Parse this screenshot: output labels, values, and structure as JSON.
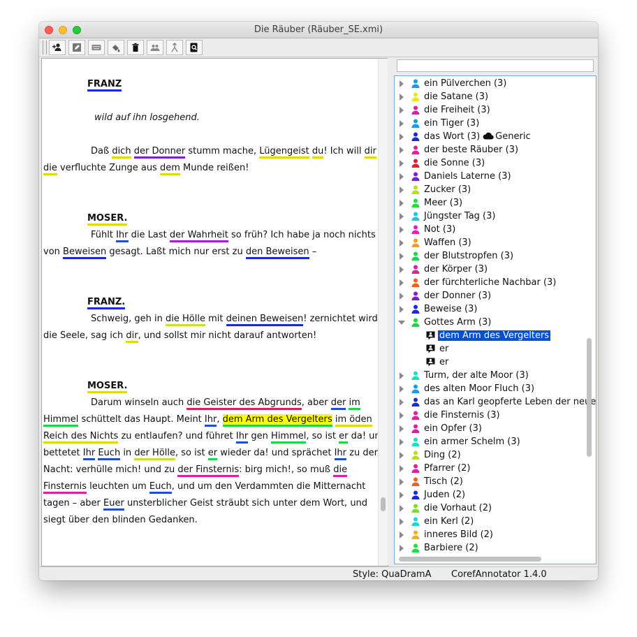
{
  "window": {
    "title": "Die Räuber (Räuber_SE.xmi)"
  },
  "toolbar": {
    "buttons": [
      "add-entity-icon",
      "edit-icon",
      "keyboard-icon",
      "paint-bucket-icon",
      "trash-icon",
      "group-icon",
      "merge-icon",
      "search-document-icon"
    ]
  },
  "editor": {
    "lines": [
      [
        {
          "t": "FRANZ",
          "c": "#1a2bd6",
          "b": true
        }
      ],
      [
        {
          "t": "wild auf ihn losgehend.",
          "i": true
        }
      ],
      [
        {
          "t": "Daß "
        },
        {
          "t": "dich",
          "c": "#dddd00"
        },
        {
          "t": " "
        },
        {
          "t": "der Donner",
          "c": "#7a1fd6"
        },
        {
          "t": " stumm mache, "
        },
        {
          "t": "Lügengeist",
          "c": "#dddd00"
        },
        {
          "t": " "
        },
        {
          "t": "du",
          "c": "#dddd00"
        },
        {
          "t": "! Ich will "
        },
        {
          "t": "dir",
          "c": "#dddd00"
        }
      ],
      [
        {
          "t": "die",
          "c": "#dddd00"
        },
        {
          "t": " verfluchte Zunge aus "
        },
        {
          "t": "dem",
          "c": "#dddd00"
        },
        {
          "t": " Munde reißen!"
        }
      ],
      [
        {
          "t": "MOSER.",
          "c": "#dddd00",
          "b": true
        }
      ],
      [
        {
          "t": "Fühlt "
        },
        {
          "t": "Ihr",
          "c": "#1a4fd6"
        },
        {
          "t": " die Last "
        },
        {
          "t": "der Wahrheit",
          "c": "#a31fd6"
        },
        {
          "t": " so früh? Ich habe ja noch nichts"
        }
      ],
      [
        {
          "t": "von "
        },
        {
          "t": "Beweisen",
          "c": "#1a2bd6"
        },
        {
          "t": " gesagt. Laßt mich nur erst zu "
        },
        {
          "t": "den Beweisen",
          "c": "#1a2bd6"
        },
        {
          "t": " –"
        }
      ],
      [
        {
          "t": "FRANZ.",
          "c": "#1a2bd6",
          "b": true
        }
      ],
      [
        {
          "t": "Schweig, geh in "
        },
        {
          "t": "die Hölle",
          "c": "#c8e02a"
        },
        {
          "t": " mit "
        },
        {
          "t": "deinen Beweisen",
          "c": "#1a2bd6"
        },
        {
          "t": "! zernichtet wird"
        }
      ],
      [
        {
          "t": "die Seele, sag ich "
        },
        {
          "t": "dir",
          "c": "#dddd00"
        },
        {
          "t": ", und sollst mir nicht darauf antworten!"
        }
      ],
      [
        {
          "t": "MOSER.",
          "c": "#dddd00",
          "b": true
        }
      ],
      [
        {
          "t": "Darum winseln auch "
        },
        {
          "t": "die Geister des Abgrunds",
          "c": "#e0205a"
        },
        {
          "t": ", aber "
        },
        {
          "t": "der",
          "c": "#1a4fd6"
        },
        {
          "t": " "
        },
        {
          "t": "im",
          "c": "#1ad64a"
        }
      ],
      [
        {
          "t": "Himmel",
          "c": "#1ad64a"
        },
        {
          "t": " schüttelt das Haupt. Meint "
        },
        {
          "t": "Ihr",
          "c": "#1a4fd6"
        },
        {
          "t": ", "
        },
        {
          "t": "dem Arm des Vergelters",
          "c": "#1ad64a",
          "h": true
        },
        {
          "t": "  "
        },
        {
          "t": "im öden",
          "c": "#dddd00"
        }
      ],
      [
        {
          "t": "Reich des Nichts",
          "c": "#dddd00"
        },
        {
          "t": " zu entlaufen? und führet "
        },
        {
          "t": "Ihr",
          "c": "#1a4fd6"
        },
        {
          "t": " gen "
        },
        {
          "t": "Himmel",
          "c": "#1ad64a"
        },
        {
          "t": ", so ist "
        },
        {
          "t": "er",
          "c": "#1ad64a"
        },
        {
          "t": " da! und"
        }
      ],
      [
        {
          "t": "bettetet "
        },
        {
          "t": "Ihr",
          "c": "#1a4fd6"
        },
        {
          "t": " "
        },
        {
          "t": "Euch",
          "c": "#1a4fd6"
        },
        {
          "t": " in "
        },
        {
          "t": "der Hölle",
          "c": "#c8e02a"
        },
        {
          "t": ", so ist "
        },
        {
          "t": "er",
          "c": "#1ad64a"
        },
        {
          "t": " wieder da! und sprächet "
        },
        {
          "t": "Ihr",
          "c": "#1a4fd6"
        },
        {
          "t": " zu der"
        }
      ],
      [
        {
          "t": "Nacht: verhülle mich! und zu "
        },
        {
          "t": "der Finsternis",
          "c": "#e020a0"
        },
        {
          "t": ": birg mich!, so muß "
        },
        {
          "t": "die",
          "c": "#e020a0"
        }
      ],
      [
        {
          "t": "Finsternis",
          "c": "#e020a0"
        },
        {
          "t": " leuchten um "
        },
        {
          "t": "Euch",
          "c": "#1a4fd6"
        },
        {
          "t": ", und um den Verdammten die Mitternacht"
        }
      ],
      [
        {
          "t": "tagen – aber "
        },
        {
          "t": "Euer",
          "c": "#1a4fd6"
        },
        {
          "t": " unsterblicher Geist sträubt sich unter dem Wort, und"
        }
      ],
      [
        {
          "t": "siegt über den blinden Gedanken."
        }
      ]
    ]
  },
  "tree": {
    "items": [
      {
        "label": "ein Pülverchen (3)",
        "color": "#1a9be0"
      },
      {
        "label": "die Satane (3)",
        "color": "#e8e81a"
      },
      {
        "label": "die Freiheit (3)",
        "color": "#e020a0"
      },
      {
        "label": "ein Tiger (3)",
        "color": "#1a9be0"
      },
      {
        "label": "das Wort (3)",
        "color": "#1a2bd6",
        "suffix": "Generic"
      },
      {
        "label": "der beste Räuber (3)",
        "color": "#e020a0"
      },
      {
        "label": "die Sonne (3)",
        "color": "#e02030"
      },
      {
        "label": "Daniels Laterne (3)",
        "color": "#7a1fd6"
      },
      {
        "label": "Zucker (3)",
        "color": "#b8e01a"
      },
      {
        "label": "Meer (3)",
        "color": "#20e040"
      },
      {
        "label": "Jüngster Tag (3)",
        "color": "#1ac8e0"
      },
      {
        "label": "Not (3)",
        "color": "#e020c0"
      },
      {
        "label": "Waffen (3)",
        "color": "#f0a020"
      },
      {
        "label": "der Blutstropfen (3)",
        "color": "#1ad64a"
      },
      {
        "label": "der Körper (3)",
        "color": "#e020a0"
      },
      {
        "label": "der fürchterliche Nachbar (3)",
        "color": "#f06020"
      },
      {
        "label": "der Donner (3)",
        "color": "#7a1fd6"
      },
      {
        "label": "Beweise (3)",
        "color": "#1a2bd6"
      },
      {
        "label": "Gottes Arm (3)",
        "color": "#1ad64a",
        "expanded": true
      },
      {
        "mention": "dem Arm des Vergelters",
        "selected": true
      },
      {
        "mention": "er"
      },
      {
        "mention": "er"
      },
      {
        "label": "Turm, der alte Moor  (3)",
        "color": "#1ae0c8"
      },
      {
        "label": "des alten Moor Fluch (3)",
        "color": "#1a9be0"
      },
      {
        "label": "das an Karl geopferte Leben der neue",
        "color": "#1a2bd6"
      },
      {
        "label": "die Finsternis (3)",
        "color": "#e020a0"
      },
      {
        "label": "ein Opfer (3)",
        "color": "#e020a0"
      },
      {
        "label": "ein armer Schelm (3)",
        "color": "#1ae0c8"
      },
      {
        "label": "Ding (2)",
        "color": "#b8e01a"
      },
      {
        "label": "Pfarrer (2)",
        "color": "#e020a0"
      },
      {
        "label": "Tisch (2)",
        "color": "#f06020"
      },
      {
        "label": "Juden (2)",
        "color": "#1a2bd6"
      },
      {
        "label": "die Vorhaut (2)",
        "color": "#7ae01a"
      },
      {
        "label": "ein Kerl (2)",
        "color": "#1ad6e0"
      },
      {
        "label": "inneres Bild (2)",
        "color": "#f0b020"
      },
      {
        "label": "Barbiere (2)",
        "color": "#20e040"
      }
    ]
  },
  "status": {
    "style": "Style: QuaDramA",
    "app": "CorefAnnotator 1.4.0"
  }
}
